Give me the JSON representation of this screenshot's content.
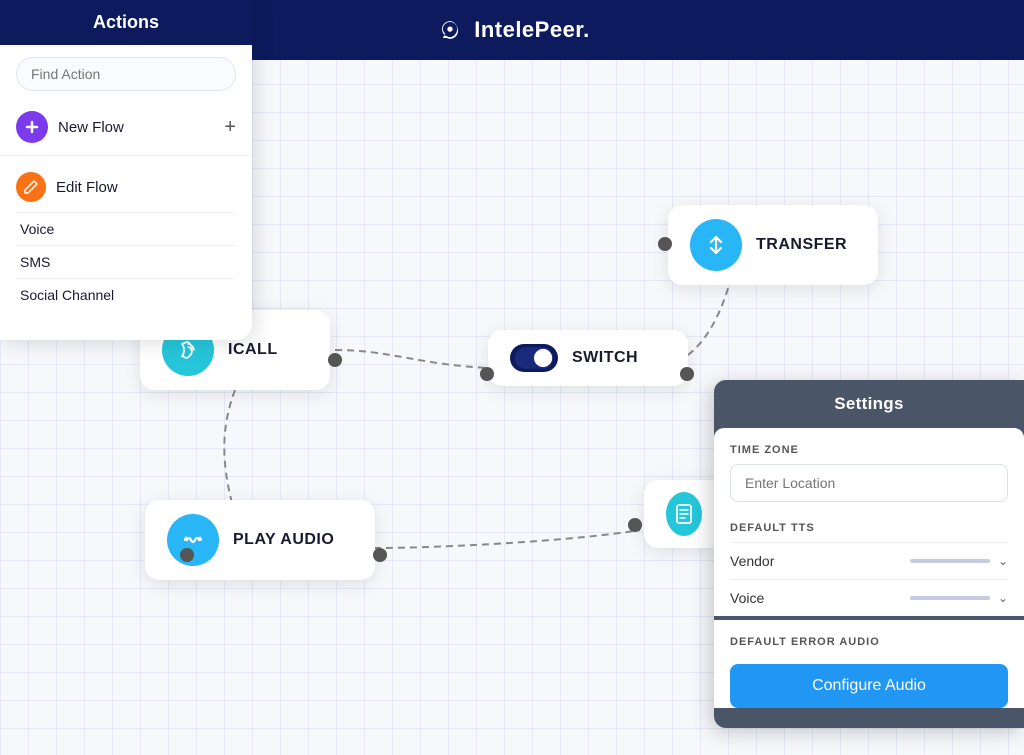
{
  "sidebar": {
    "title": "Actions",
    "search_placeholder": "Find Action",
    "new_flow_label": "New Flow",
    "new_flow_plus": "+",
    "edit_flow_label": "Edit Flow",
    "menu_items": [
      "Voice",
      "SMS",
      "Social Channel"
    ]
  },
  "header": {
    "logo_text": "IntelePeer."
  },
  "nodes": {
    "icall": {
      "label": "ICALL"
    },
    "play_audio": {
      "label": "PLAY AUDIO"
    },
    "switch": {
      "label": "SWITCH"
    },
    "transfer": {
      "label": "TRANSFER"
    }
  },
  "settings": {
    "title": "Settings",
    "timezone_label": "TIME ZONE",
    "timezone_placeholder": "Enter Location",
    "default_tts_label": "DEFAULT TTS",
    "vendor_label": "Vendor",
    "voice_label": "Voice",
    "default_error_audio_label": "DEFAULT ERROR AUDIO",
    "configure_audio_btn": "Configure Audio"
  }
}
